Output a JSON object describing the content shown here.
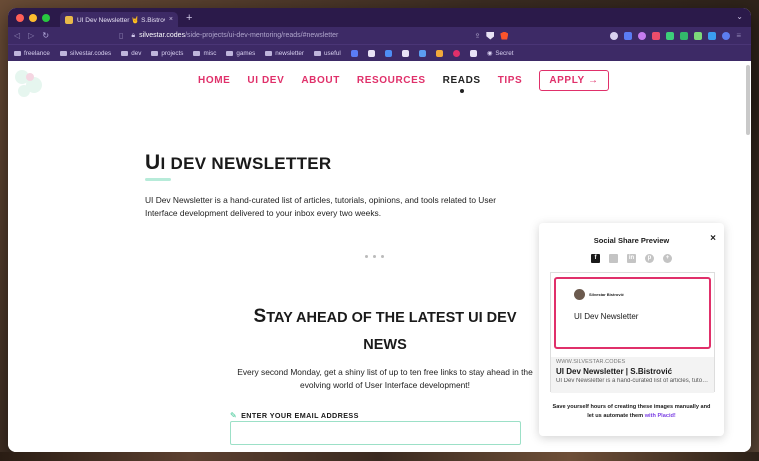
{
  "browser": {
    "tab": {
      "title": "UI Dev Newsletter 🤘 S.Bistrović",
      "close": "×"
    },
    "new_tab": "+",
    "tab_menu": "⌄",
    "url_domain": "silvestar.codes",
    "url_path": "/side-projects/ui-dev-mentoring/reads/#newsletter",
    "bookmarks": [
      {
        "label": "freelance"
      },
      {
        "label": "silvestar.codes"
      },
      {
        "label": "dev"
      },
      {
        "label": "projects"
      },
      {
        "label": "misc"
      },
      {
        "label": "games"
      },
      {
        "label": "newsletter"
      },
      {
        "label": "useful"
      }
    ],
    "bookmark_secret": "Secret"
  },
  "nav": {
    "items": [
      "HOME",
      "UI DEV",
      "ABOUT",
      "RESOURCES",
      "READS",
      "TIPS"
    ],
    "active_index": 4,
    "apply_label": "APPLY →"
  },
  "main": {
    "title_first": "U",
    "title_rest": "I DEV NEWSLETTER",
    "intro": "UI Dev Newsletter is a hand-curated list of articles, tutorials, opinions, and tools related to User Interface development delivered to your inbox every two weeks.",
    "cta_title_first": "S",
    "cta_title_rest": "TAY AHEAD OF THE LATEST UI DEV NEWS",
    "cta_sub": "Every second Monday, get a shiny list of up to ten free links to stay ahead in the evolving world of User Interface development!",
    "email_label": "ENTER YOUR EMAIL ADDRESS"
  },
  "preview": {
    "title": "Social Share Preview",
    "close": "×",
    "card_author": "Silvestar Bistrović",
    "card_title": "UI Dev Newsletter",
    "domain": "WWW.SILVESTAR.CODES",
    "headline": "UI Dev Newsletter | S.Bistrović",
    "description": "UI Dev Newsletter is a hand-curated list of articles, tutorials, opinions, and tools",
    "footer_text": "Save yourself hours of creating these images manually and let us automate them",
    "footer_link": "with Placid!"
  },
  "colors": {
    "accent": "#e0306a",
    "mint": "#9ce0c7",
    "browser_chrome": "#3d2a66",
    "placid": "#7b3fe4"
  }
}
